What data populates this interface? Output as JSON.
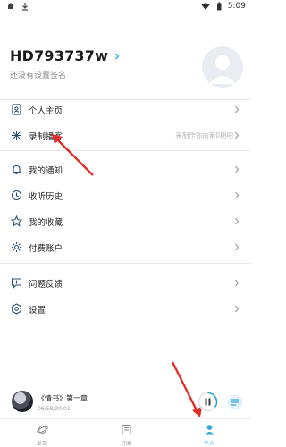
{
  "status_bar": {
    "time": "5:09",
    "icons": [
      "notification-icon",
      "download-icon",
      "wifi-icon",
      "battery-icon"
    ]
  },
  "profile": {
    "username": "HD793737w",
    "signature": "还没有设置签名",
    "avatar_icon": "default-avatar-icon"
  },
  "menu": {
    "items": [
      {
        "label": "个人主页",
        "icon": "profile-page-icon",
        "hint": ""
      },
      {
        "label": "录制播客",
        "icon": "record-podcast-icon",
        "hint": "来制作你的第0期吧"
      },
      {
        "label": "我的通知",
        "icon": "bell-icon",
        "hint": ""
      },
      {
        "label": "收听历史",
        "icon": "clock-icon",
        "hint": ""
      },
      {
        "label": "我的收藏",
        "icon": "star-icon",
        "hint": ""
      },
      {
        "label": "付费账户",
        "icon": "gear-icon",
        "hint": ""
      },
      {
        "label": "问题反馈",
        "icon": "feedback-icon",
        "hint": ""
      },
      {
        "label": "设置",
        "icon": "settings-icon",
        "hint": ""
      }
    ]
  },
  "player": {
    "title": "《情书》第一章",
    "time": "06:58/20:01",
    "progress": 0.35
  },
  "tabbar": {
    "tabs": [
      {
        "label": "发现",
        "icon": "planet-icon",
        "active": false
      },
      {
        "label": "订阅",
        "icon": "subscribe-icon",
        "active": false
      },
      {
        "label": "个人",
        "icon": "person-icon",
        "active": true
      }
    ]
  },
  "colors": {
    "accent": "#2aa6d8",
    "arrow": "#e0302c",
    "text": "#222222",
    "muted": "#888888"
  }
}
